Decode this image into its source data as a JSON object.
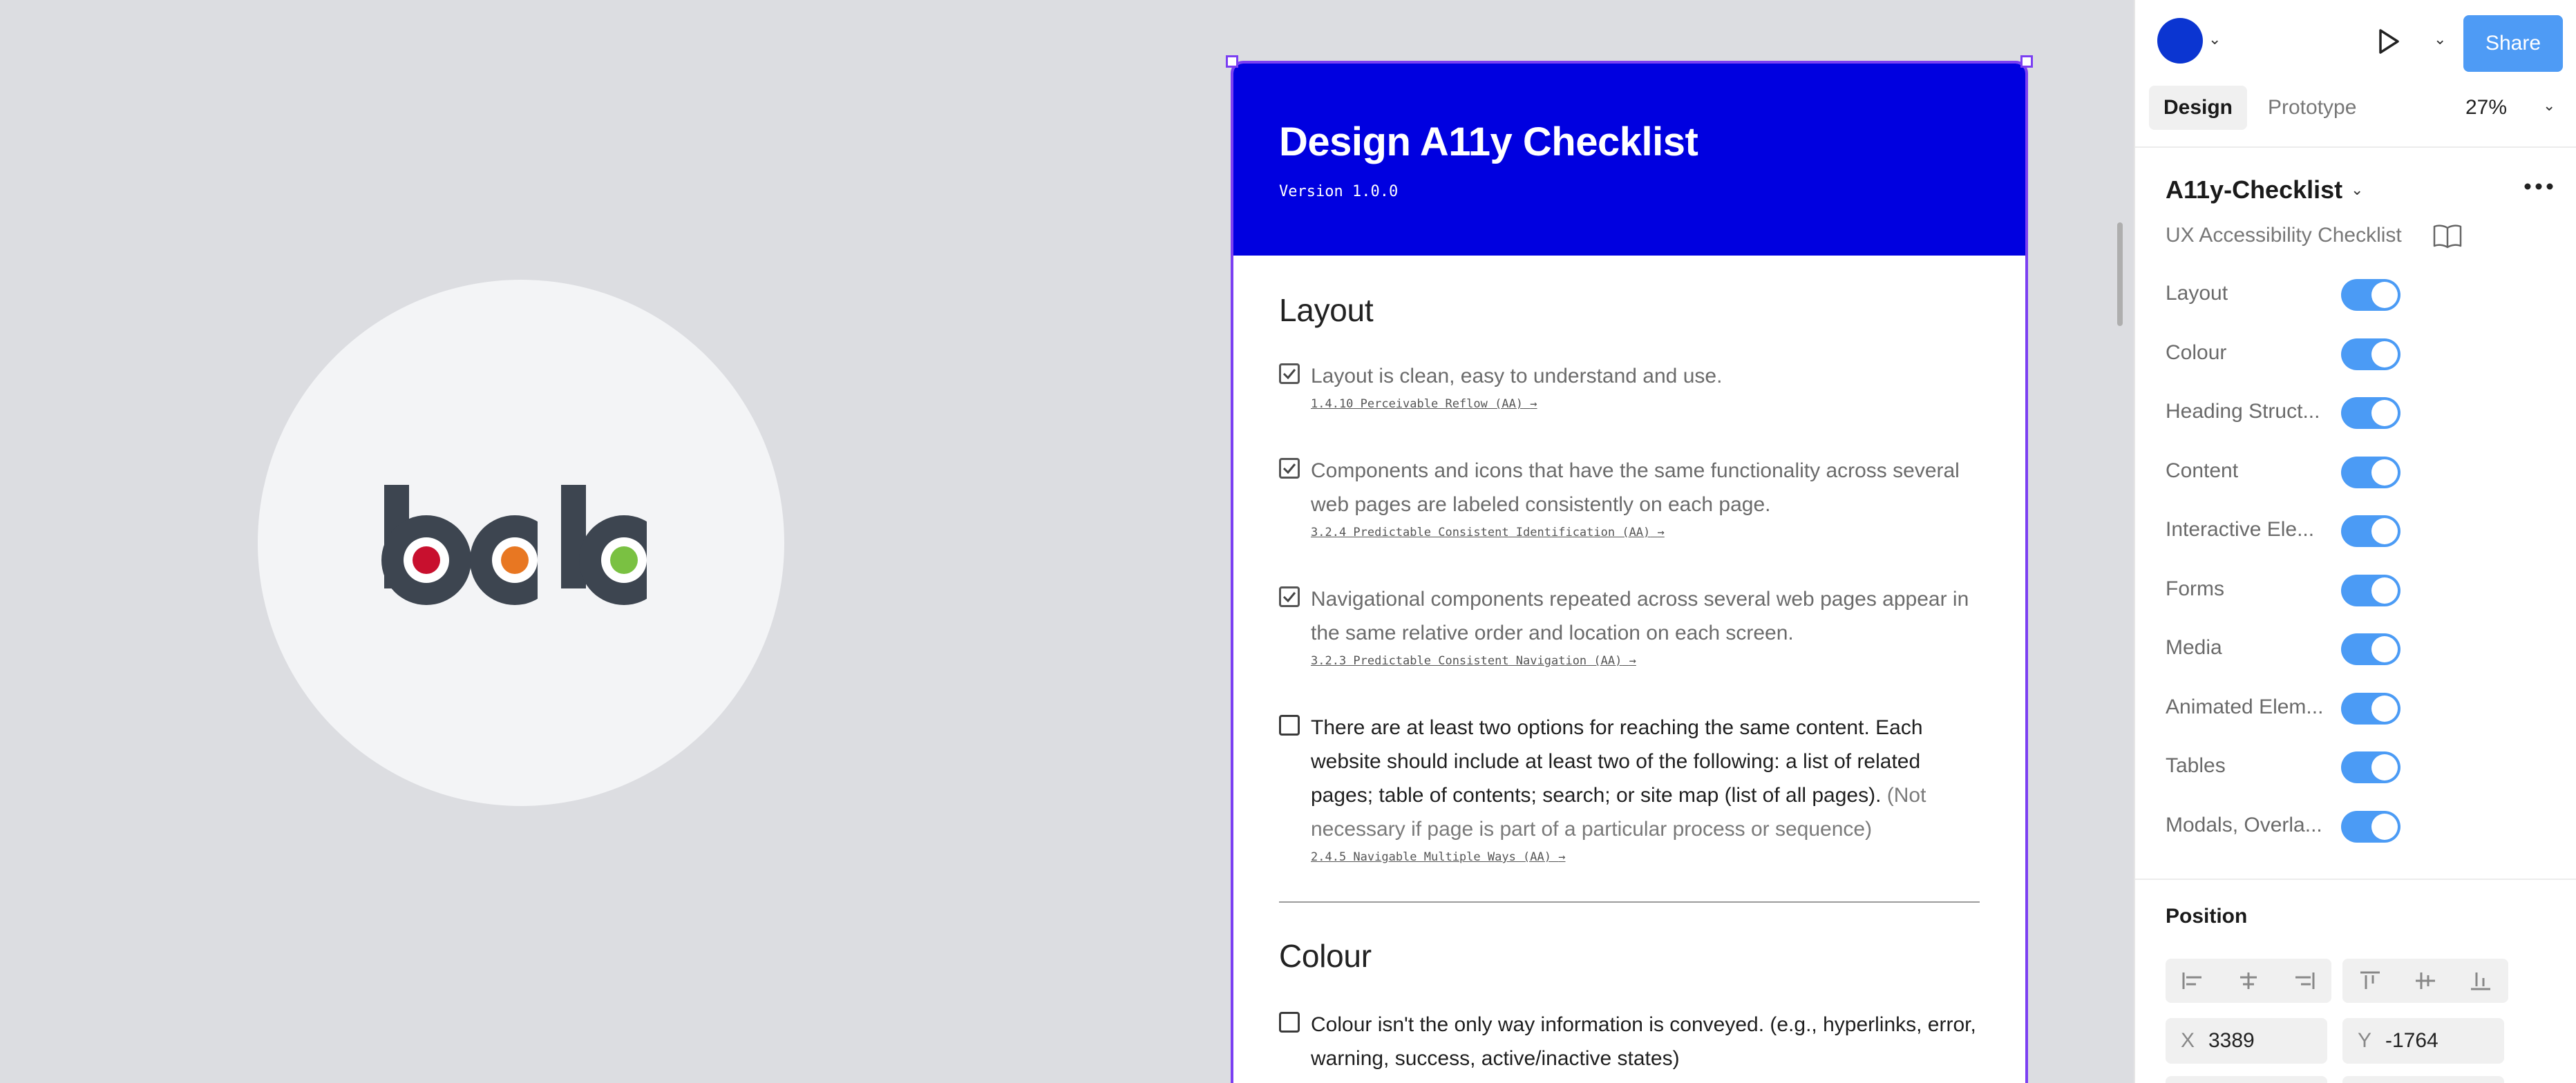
{
  "colors": {
    "canvas_bg": "#dcdde1",
    "frame_header": "#0000e0",
    "selection": "#7b3ff2",
    "share_button": "#4e9bf5",
    "toggle_on": "#4b9bf5",
    "avatar": "#0b35d1",
    "logo_dark": "#3d4550",
    "logo_red": "#c8102e",
    "logo_orange": "#e87722",
    "logo_green": "#7ac142"
  },
  "logo": {
    "text": "bclc"
  },
  "frame": {
    "title": "Design A11y Checklist",
    "version": "Version 1.0.0",
    "sections": [
      {
        "title": "Layout",
        "items": [
          {
            "checked": true,
            "text": "Layout is clean, easy to understand and use.",
            "note": "",
            "link": "1.4.10 Perceivable Reflow (AA)"
          },
          {
            "checked": true,
            "text": "Components and icons that have the same functionality across several web pages are labeled consistently on each page.",
            "note": "",
            "link": "3.2.4 Predictable Consistent Identification (AA)"
          },
          {
            "checked": true,
            "text": "Navigational components repeated across several web pages appear in the same relative order and location on each screen.",
            "note": "",
            "link": "3.2.3 Predictable Consistent Navigation (AA)"
          },
          {
            "checked": false,
            "text": "There are at least two options for reaching the same content. Each website should include at least two of the following: a list of related pages; table of contents; search; or site map (list of all pages).",
            "note": " (Not necessary if page is part of a particular process or sequence)",
            "link": "2.4.5 Navigable Multiple Ways (AA)"
          }
        ]
      },
      {
        "title": "Colour",
        "items": [
          {
            "checked": false,
            "text": "Colour isn't the only way information is conveyed. (e.g., hyperlinks, error, warning, success, active/inactive states)",
            "note": "",
            "link": ""
          }
        ]
      }
    ]
  },
  "panel": {
    "share_label": "Share",
    "tabs": {
      "design": "Design",
      "prototype": "Prototype"
    },
    "zoom": "27%",
    "component_name": "A11y-Checklist",
    "component_desc": "UX Accessibility Checklist",
    "toggles": [
      {
        "label": "Layout",
        "on": true
      },
      {
        "label": "Colour",
        "on": true
      },
      {
        "label": "Heading Struct...",
        "on": true
      },
      {
        "label": "Content",
        "on": true
      },
      {
        "label": "Interactive Ele...",
        "on": true
      },
      {
        "label": "Forms",
        "on": true
      },
      {
        "label": "Media",
        "on": true
      },
      {
        "label": "Animated Elem...",
        "on": true
      },
      {
        "label": "Tables",
        "on": true
      },
      {
        "label": "Modals, Overla...",
        "on": true
      }
    ],
    "position": {
      "label": "Position",
      "x_label": "X",
      "x": "3389",
      "y_label": "Y",
      "y": "-1764"
    }
  }
}
